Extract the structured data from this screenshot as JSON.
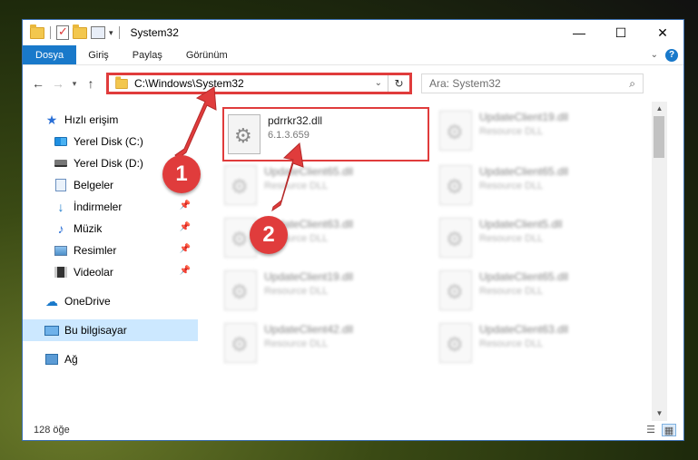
{
  "window": {
    "title": "System32",
    "controls": {
      "minimize": "—",
      "maximize": "☐",
      "close": "✕"
    }
  },
  "ribbon": {
    "tabs": [
      {
        "label": "Dosya",
        "active": true
      },
      {
        "label": "Giriş",
        "active": false
      },
      {
        "label": "Paylaş",
        "active": false
      },
      {
        "label": "Görünüm",
        "active": false
      }
    ]
  },
  "address": {
    "path": "C:\\Windows\\System32",
    "search_placeholder": "Ara: System32"
  },
  "sidebar": {
    "items": [
      {
        "label": "Hızlı erişim",
        "icon": "star-icon",
        "level": 1
      },
      {
        "label": "Yerel Disk (C:)",
        "icon": "drive-c-icon",
        "level": 2
      },
      {
        "label": "Yerel Disk (D:)",
        "icon": "drive-d-icon",
        "level": 2
      },
      {
        "label": "Belgeler",
        "icon": "documents-icon",
        "level": 2
      },
      {
        "label": "İndirmeler",
        "icon": "downloads-icon",
        "level": 2,
        "pinned": true
      },
      {
        "label": "Müzik",
        "icon": "music-icon",
        "level": 2,
        "pinned": true
      },
      {
        "label": "Resimler",
        "icon": "pictures-icon",
        "level": 2,
        "pinned": true
      },
      {
        "label": "Videolar",
        "icon": "videos-icon",
        "level": 2,
        "pinned": true
      },
      {
        "label": "OneDrive",
        "icon": "onedrive-icon",
        "level": 1
      },
      {
        "label": "Bu bilgisayar",
        "icon": "computer-icon",
        "level": 1,
        "selected": true
      },
      {
        "label": "Ağ",
        "icon": "network-icon",
        "level": 1
      }
    ]
  },
  "files": {
    "highlighted": {
      "name": "pdrrkr32.dll",
      "version": "6.1.3.659"
    },
    "background": [
      {
        "name": "UpdateClient19.dll",
        "desc": "Resource DLL"
      },
      {
        "name": "UpdateClient65.dll",
        "desc": "Resource DLL"
      },
      {
        "name": "UpdateClient65.dll",
        "desc": "Resource DLL"
      },
      {
        "name": "UpdateClient63.dll",
        "desc": "Resource DLL"
      },
      {
        "name": "UpdateClient5.dll",
        "desc": "Resource DLL"
      },
      {
        "name": "UpdateClient19.dll",
        "desc": "Resource DLL"
      },
      {
        "name": "UpdateClient65.dll",
        "desc": "Resource DLL"
      },
      {
        "name": "UpdateClient42.dll",
        "desc": "Resource DLL"
      },
      {
        "name": "UpdateClient63.dll",
        "desc": "Resource DLL"
      }
    ]
  },
  "status": {
    "count": "128 öğe"
  },
  "annotations": {
    "step1": "1",
    "step2": "2"
  },
  "colors": {
    "accent": "#1979ca",
    "highlight": "#e03c3c",
    "selection": "#cce8ff"
  }
}
